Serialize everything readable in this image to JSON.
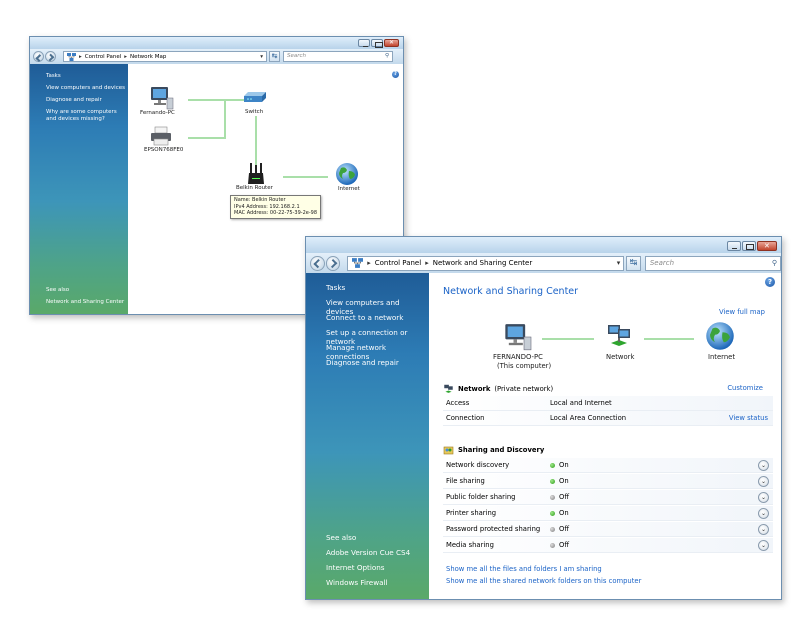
{
  "network_map_window": {
    "breadcrumb": [
      "Control Panel",
      "Network Map"
    ],
    "search_placeholder": "Search",
    "sidebar": {
      "tasks_heading": "Tasks",
      "tasks": [
        "View computers and devices",
        "Diagnose and repair",
        "Why are some computers and devices missing?"
      ],
      "see_also_heading": "See also",
      "see_also": [
        "Network and Sharing Center"
      ]
    },
    "devices": {
      "pc": "Fernando-PC",
      "printer": "EPSON768FE0",
      "switch": "Switch",
      "router": "Belkin Router",
      "internet": "Internet"
    },
    "tooltip": [
      "Name: Belkin Router",
      "IPv4 Address: 192.168.2.1",
      "MAC Address: 00-22-75-39-2e-98"
    ]
  },
  "sharing_window": {
    "breadcrumb": [
      "Control Panel",
      "Network and Sharing Center"
    ],
    "search_placeholder": "Search",
    "sidebar": {
      "tasks_heading": "Tasks",
      "tasks": [
        "View computers and devices",
        "Connect to a network",
        "Set up a connection or network",
        "Manage network connections",
        "Diagnose and repair"
      ],
      "see_also_heading": "See also",
      "see_also": [
        "Adobe Version Cue CS4",
        "Internet Options",
        "Windows Firewall"
      ]
    },
    "title": "Network and Sharing Center",
    "view_full_map": "View full map",
    "map": {
      "computer_name": "FERNANDO-PC",
      "computer_sub": "(This computer)",
      "network": "Network",
      "internet": "Internet"
    },
    "network_section": {
      "name": "Network",
      "type": "(Private network)",
      "customize": "Customize",
      "rows": [
        {
          "key": "Access",
          "value": "Local and Internet",
          "action": ""
        },
        {
          "key": "Connection",
          "value": "Local Area Connection",
          "action": "View status"
        }
      ]
    },
    "sharing_section": {
      "heading": "Sharing and Discovery",
      "rows": [
        {
          "key": "Network discovery",
          "state": "On"
        },
        {
          "key": "File sharing",
          "state": "On"
        },
        {
          "key": "Public folder sharing",
          "state": "Off"
        },
        {
          "key": "Printer sharing",
          "state": "On"
        },
        {
          "key": "Password protected sharing",
          "state": "Off"
        },
        {
          "key": "Media sharing",
          "state": "Off"
        }
      ]
    },
    "bottom_links": [
      "Show me all the files and folders I am sharing",
      "Show me all the shared network folders on this computer"
    ]
  }
}
